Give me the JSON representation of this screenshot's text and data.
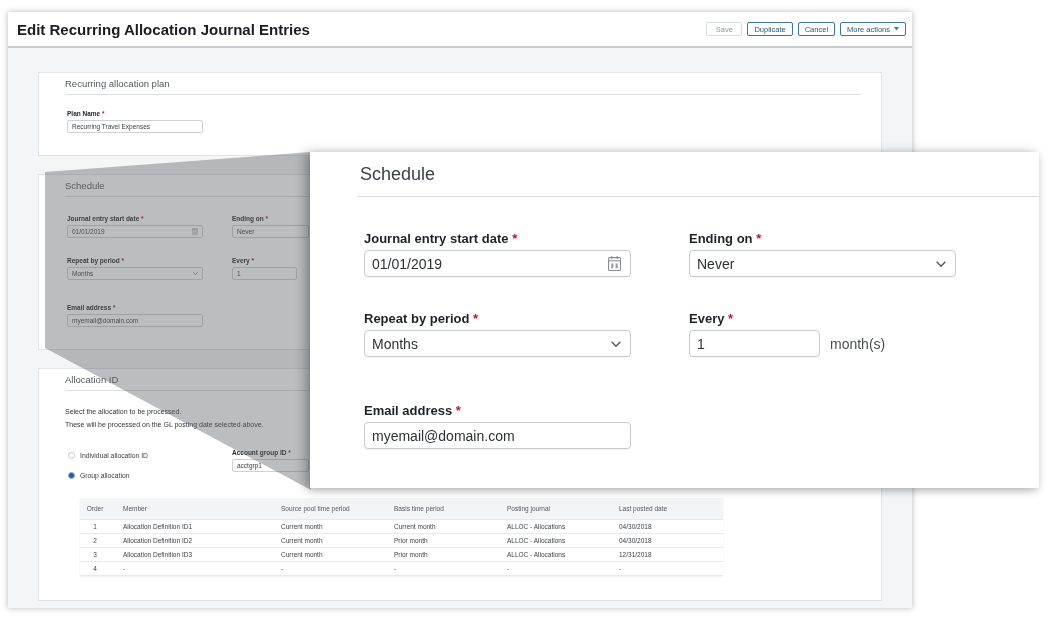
{
  "window": {
    "title": "Edit Recurring Allocation Journal Entries",
    "buttons": [
      {
        "label": "Save",
        "disabled": true,
        "kind": "plain"
      },
      {
        "label": "Duplicate",
        "disabled": false,
        "kind": "plain"
      },
      {
        "label": "Cancel",
        "disabled": false,
        "kind": "plain"
      },
      {
        "label": "More actions",
        "disabled": false,
        "kind": "menu"
      }
    ]
  },
  "plan_section": {
    "title": "Recurring allocation plan",
    "fields": [
      {
        "label": "Plan Name",
        "required_mark": "*",
        "value": "Recurring Travel Expenses"
      }
    ]
  },
  "schedule_section": {
    "title": "Schedule",
    "fields": [
      {
        "label": "Journal entry start date",
        "required_mark": "*",
        "value": "01/01/2019",
        "kind": "date"
      },
      {
        "label": "Ending on",
        "required_mark": "*",
        "value": "Never",
        "kind": "text"
      },
      {
        "label": "Repeat by period",
        "required_mark": "*",
        "value": "Months",
        "kind": "select"
      },
      {
        "label": "Every",
        "required_mark": "*",
        "value": "1",
        "kind": "number"
      },
      {
        "label": "Email address",
        "required_mark": "*",
        "value": "myemail@domain.com",
        "kind": "text"
      }
    ]
  },
  "allocation_section": {
    "title": "Allocation ID",
    "description": [
      "Select the allocation to be processed.",
      "These will be processed on the GL posting date selected above."
    ],
    "options": [
      {
        "label": "Individual allocation ID",
        "selected": false
      },
      {
        "label": "Group allocation",
        "selected": true
      }
    ],
    "account_group": {
      "label": "Account group ID",
      "required_mark": "*",
      "value": "acctgrp1"
    },
    "table": {
      "columns": [
        "Order",
        "Member",
        "Source pool time period",
        "Basis time period",
        "Posting journal",
        "Last posted date"
      ],
      "rows": [
        [
          "1",
          "Allocation Definition ID1",
          "Current month",
          "Current month",
          "ALLOC - Allocations",
          "04/30/2018"
        ],
        [
          "2",
          "Allocation Definition ID2",
          "Current month",
          "Prior month",
          "ALLOC - Allocations",
          "04/30/2018"
        ],
        [
          "3",
          "Allocation Definition ID3",
          "Current month",
          "Prior month",
          "ALLOC - Allocations",
          "12/31/2018"
        ],
        [
          "4",
          "-",
          "-",
          "-",
          "-",
          "-"
        ]
      ]
    }
  },
  "zoom_panel": {
    "title": "Schedule",
    "fields": [
      {
        "label": "Journal entry start date",
        "required_mark": "*",
        "value": "01/01/2019",
        "kind": "date"
      },
      {
        "label": "Ending on",
        "required_mark": "*",
        "value": "Never",
        "kind": "select"
      },
      {
        "label": "Repeat by period",
        "required_mark": "*",
        "value": "Months",
        "kind": "select"
      },
      {
        "label": "Every",
        "required_mark": "*",
        "value": "1",
        "kind": "number",
        "unit": "month(s)"
      },
      {
        "label": "Email address",
        "required_mark": "*",
        "value": "myemail@domain.com",
        "kind": "text"
      }
    ]
  }
}
